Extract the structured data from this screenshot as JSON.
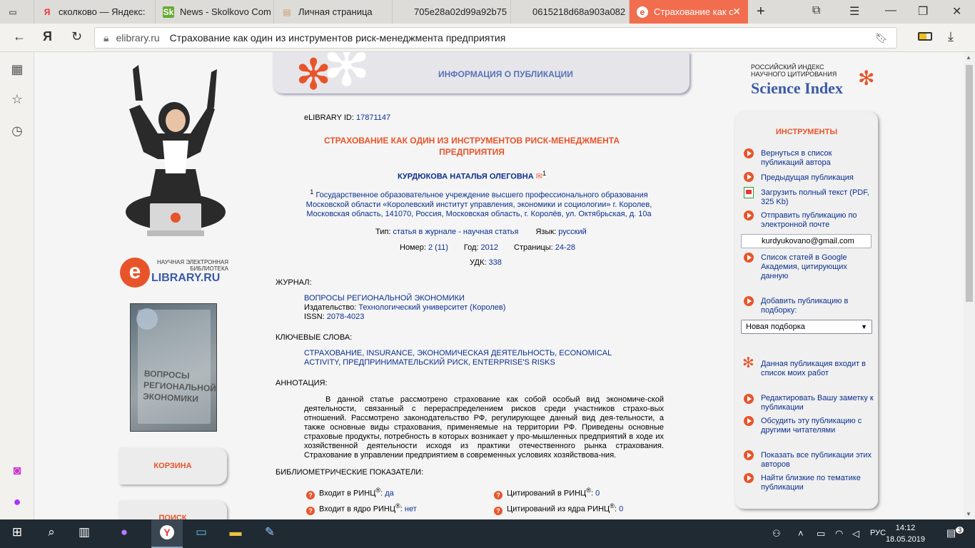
{
  "browser": {
    "tabs": [
      {
        "label": "",
        "icon": "sidebar-toggle-icon"
      },
      {
        "label": "сколково — Яндекс:",
        "icon": "yandex-icon"
      },
      {
        "label": "News - Skolkovo Com",
        "icon": "sk-icon"
      },
      {
        "label": "Личная страница",
        "icon": "page-icon"
      },
      {
        "label": "705e28a02d99a92b75",
        "icon": ""
      },
      {
        "label": "0615218d68a903a082",
        "icon": ""
      },
      {
        "label": "Страхование как с",
        "icon": "elibrary-icon"
      }
    ],
    "url_domain": "elibrary.ru",
    "url_title": "Страхование как один из инструментов риск-менеджмента предприятия"
  },
  "header": {
    "label": "ИНФОРМАЦИЯ О ПУБЛИКАЦИИ"
  },
  "left": {
    "elibrary_small": "НАУЧНАЯ ЭЛЕКТРОННАЯ БИБЛИОТЕКА",
    "elibrary_big": "LIBRARY.RU",
    "elibrary_e": "e",
    "cover_text": "ВОПРОСЫ РЕГИОНАЛЬНОЙ ЭКОНОМИКИ",
    "cart_label": "КОРЗИНА",
    "search_label": "ПОИСК"
  },
  "pub": {
    "id_label": "eLIBRARY ID:",
    "id_value": "17871147",
    "title": "СТРАХОВАНИЕ КАК ОДИН ИЗ ИНСТРУМЕНТОВ РИСК-МЕНЕДЖМЕНТА ПРЕДПРИЯТИЯ",
    "author": "КУРДЮКОВА НАТАЛЬЯ ОЛЕГОВНА",
    "author_sup": "1",
    "affil_sup": "1",
    "affiliation": "Государственное образовательное учреждение высшего профессионального образования Московской области «Королевский институт управления, экономики и социологии» г. Королев, Московская область, 141070, Россия, Московская область, г. Королёв, ул. Октябрьская, д. 10а",
    "type_label": "Тип:",
    "type_value": "статья в журнале - научная статья",
    "lang_label": "Язык:",
    "lang_value": "русский",
    "num_label": "Номер:",
    "num_value": "2 (11)",
    "year_label": "Год:",
    "year_value": "2012",
    "pages_label": "Страницы:",
    "pages_value": "24-28",
    "udk_label": "УДК:",
    "udk_value": "338",
    "journal_head": "ЖУРНАЛ:",
    "journal_name": "ВОПРОСЫ РЕГИОНАЛЬНОЙ ЭКОНОМИКИ",
    "publisher_label": "Издательство:",
    "publisher_value": "Технологический университет (Королев)",
    "issn_label": "ISSN:",
    "issn_value": "2078-4023",
    "keywords_head": "КЛЮЧЕВЫЕ СЛОВА:",
    "keywords": "СТРАХОВАНИЕ, INSURANCE, ЭКОНОМИЧЕСКАЯ ДЕЯТЕЛЬНОСТЬ, ECONOMICAL ACTIVITY, ПРЕДПРИНИМАТЕЛЬСКИЙ РИСК, ENTERPRISE'S RISKS",
    "abstract_head": "АННОТАЦИЯ:",
    "abstract": "В данной статье рассмотрено страхование как собой особый вид экономиче-ской деятельности, связанный с перераспределением рисков среди участников страхо-вых отношений. Рассмотрено законодательство РФ, регулирующее данный вид дея-тельности, а также основные виды страхования, применяемые на территории РФ. Приведены основные страховые продукты, потребность в которых возникает у про-мышленных предприятий в ходе их хозяйственной деятельности исходя из практики отечественного рынка страхования. Страхование в управлении предприятием в современных условиях хозяйствова-ния.",
    "biblio_head": "БИБЛИОМЕТРИЧЕСКИЕ ПОКАЗАТЕЛИ:",
    "b1_label": "Входит в РИНЦ",
    "b1_value": "да",
    "b2_label": "Цитирований в РИНЦ",
    "b2_value": "0",
    "b3_label": "Входит в ядро РИНЦ",
    "b3_value": "нет",
    "b4_label": "Цитирований из ядра РИНЦ",
    "b4_value": "0",
    "reg": "®"
  },
  "sci": {
    "small": "РОССИЙСКИЙ ИНДЕКС НАУЧНОГО ЦИТИРОВАНИЯ",
    "big": "Science Index"
  },
  "tools": {
    "title": "ИНСТРУМЕНТЫ",
    "t1": "Вернуться в список публикаций автора",
    "t2": "Предыдущая публикация",
    "t3": "Загрузить полный текст (PDF, 325 Kb)",
    "t4": "Отправить публикацию по электронной почте",
    "email": "kurdyukovano@gmail.com",
    "t5": "Список статей в Google Академия, цитирующих данную",
    "t6": "Добавить публикацию в подборку:",
    "select": "Новая подборка",
    "t7": "Данная публикация входит в список моих работ",
    "t8": "Редактировать Вашу заметку к публикации",
    "t9": "Обсудить эту публикацию с другими читателями",
    "t10": "Показать все публикации этих авторов",
    "t11": "Найти близкие по тематике публикации"
  },
  "taskbar": {
    "time": "14:12",
    "date": "18.05.2019",
    "lang": "РУС",
    "notif": "3"
  }
}
